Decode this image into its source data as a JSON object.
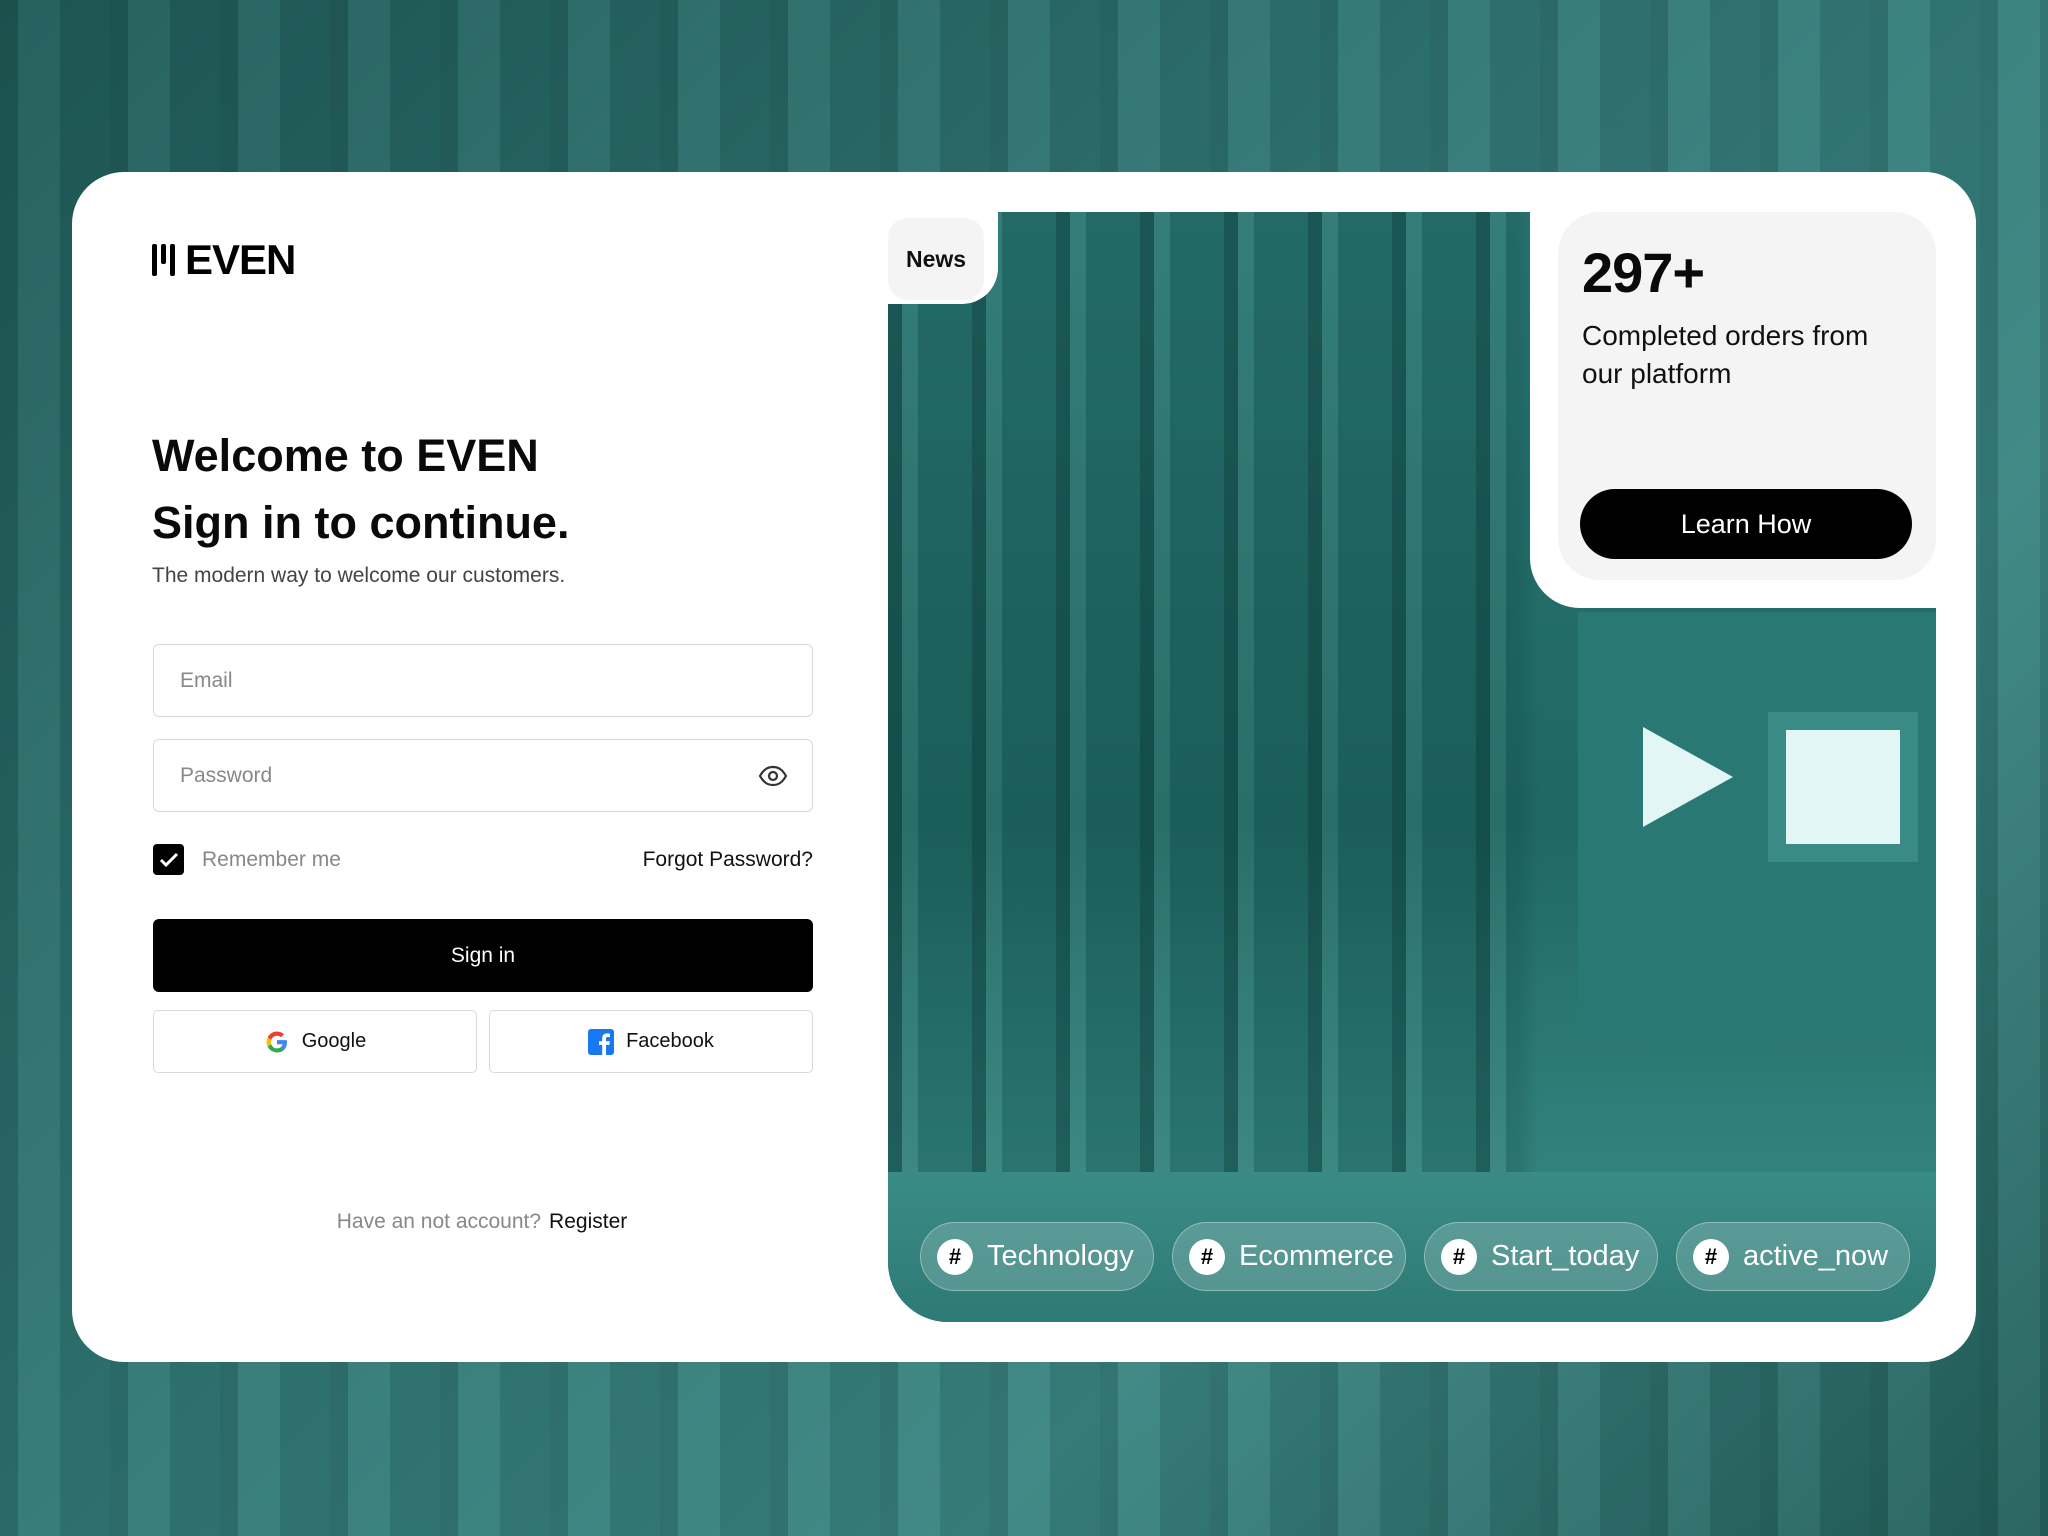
{
  "brand": {
    "name": "EVEN"
  },
  "heading": {
    "line1": "Welcome to EVEN",
    "line2": "Sign in to continue.",
    "subtitle": "The modern way to welcome our customers."
  },
  "form": {
    "email_placeholder": "Email",
    "password_placeholder": "Password",
    "remember_label": "Remember me",
    "remember_checked": true,
    "forgot_label": "Forgot Password?",
    "signin_label": "Sign in",
    "google_label": "Google",
    "facebook_label": "Facebook",
    "register_prompt": "Have an not account?",
    "register_label": "Register"
  },
  "news": {
    "label": "News"
  },
  "stats": {
    "value": "297+",
    "description": "Completed orders from our platform",
    "button_label": "Learn How"
  },
  "tags": [
    {
      "label": "Technology"
    },
    {
      "label": "Ecommerce"
    },
    {
      "label": "Start_today"
    },
    {
      "label": "active_now"
    }
  ],
  "colors": {
    "accent": "#000000",
    "background_teal": "#2f7673",
    "facebook": "#1877f2"
  }
}
